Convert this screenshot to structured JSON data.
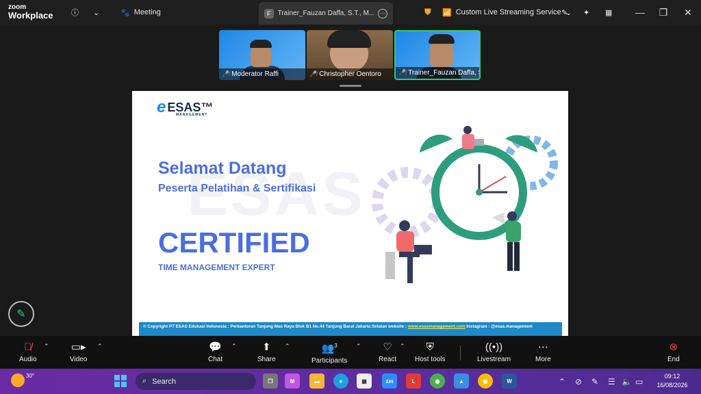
{
  "titlebar": {
    "logo_line1": "zoom",
    "logo_line2": "Workplace",
    "meeting_label": "Meeting",
    "tab_label": "Trainer_Fauzan Daffa, S.T., M....'s sc",
    "tab_badge": "F",
    "streaming_label": "Custom Live Streaming Service"
  },
  "participants": [
    {
      "name": "Moderator Raffi",
      "muted": true
    },
    {
      "name": "Christopher Oentoro",
      "muted": true
    },
    {
      "name": "Trainer_Fauzan Daffa, S.T., ...",
      "muted": true,
      "active": true
    }
  ],
  "slide": {
    "logo_text": "ESAS™",
    "logo_sub": "MANAGEMENT",
    "watermark": "ESAS",
    "welcome": "Selamat Datang",
    "welcome_sub": "Peserta Pelatihan & Sertifikasi",
    "certified": "CERTIFIED",
    "certified_sub": "TIME MANAGEMENT EXPERT",
    "footer_text": "© Copyright PT ESAS Edukasi Indonesia : Perkantoran Tanjung Mas Raya Blok B1 No.44 Tanjung Barat Jakarta Selatan website : ",
    "footer_link": "www.esasmanagement.com",
    "footer_tail": " Instagram : @esas.management"
  },
  "toolbar": {
    "audio": "Audio",
    "video": "Video",
    "chat": "Chat",
    "share": "Share",
    "participants": "Participants",
    "participants_count": "3",
    "react": "React",
    "host_tools": "Host tools",
    "livestream": "Livestream",
    "more": "More",
    "end": "End"
  },
  "taskbar": {
    "temperature": "30°",
    "search_placeholder": "Search",
    "time": "09:12",
    "date": "16/08/2026"
  },
  "colors": {
    "accent_blue": "#4a6ee0",
    "active_speaker": "#2ecc71",
    "end_red": "#e53935"
  }
}
